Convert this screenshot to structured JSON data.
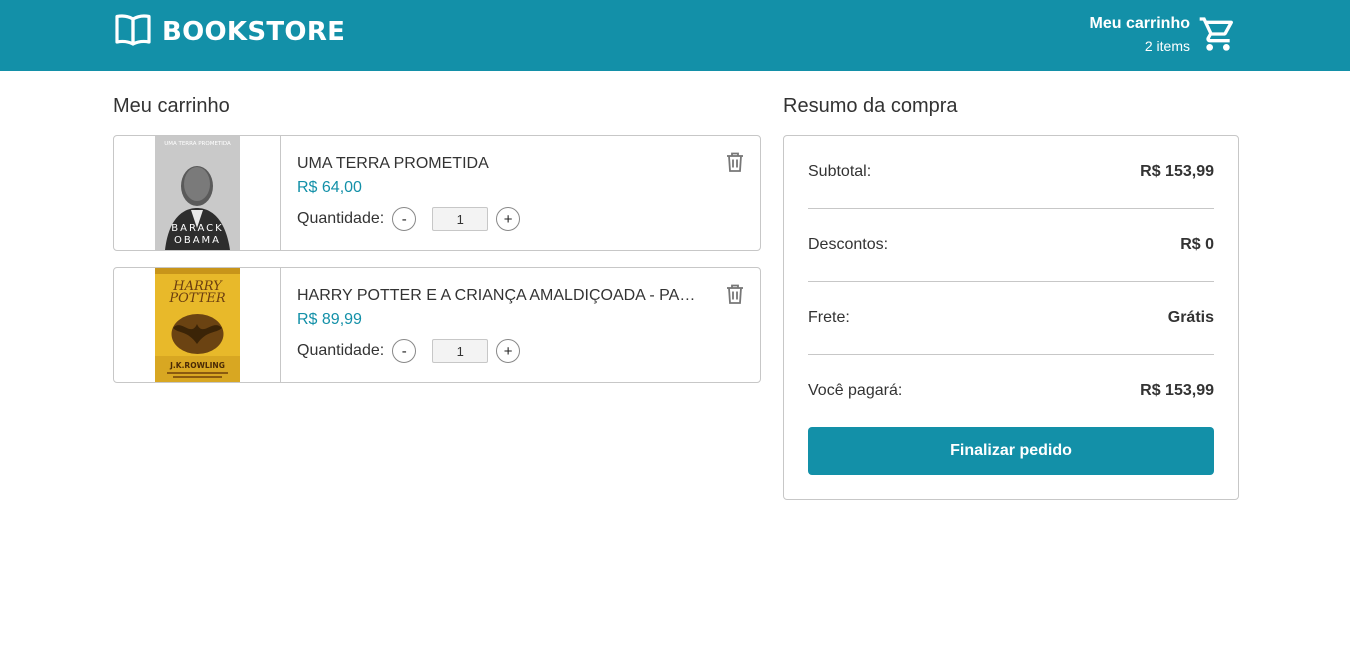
{
  "header": {
    "brand": "BOOKSTORE",
    "cart_title": "Meu carrinho",
    "cart_count": "2 items"
  },
  "cart": {
    "title": "Meu carrinho",
    "items": [
      {
        "title": "UMA TERRA PROMETIDA",
        "price": "R$ 64,00",
        "quantity_label": "Quantidade:",
        "quantity": "1",
        "decrement": "-",
        "increment": "+",
        "cover_text": [
          "UMA TERRA PROMETIDA",
          "BARACK",
          "OBAMA"
        ]
      },
      {
        "title": "HARRY POTTER E A CRIANÇA AMALDIÇOADA - PARTES I E II",
        "price": "R$ 89,99",
        "quantity_label": "Quantidade:",
        "quantity": "1",
        "decrement": "-",
        "increment": "+",
        "cover_text": [
          "HARRY",
          "POTTER",
          "J.K.ROWLING"
        ]
      }
    ]
  },
  "summary": {
    "title": "Resumo da compra",
    "rows": [
      {
        "label": "Subtotal:",
        "value": "R$ 153,99"
      },
      {
        "label": "Descontos:",
        "value": "R$ 0"
      },
      {
        "label": "Frete:",
        "value": "Grátis"
      },
      {
        "label": "Você pagará:",
        "value": "R$ 153,99"
      }
    ],
    "button": "Finalizar pedido"
  },
  "colors": {
    "brand": "#1390a8",
    "border": "#c7c7c7",
    "text": "#333333"
  },
  "icons": [
    "book-open-icon",
    "shopping-cart-icon",
    "trash-icon"
  ]
}
